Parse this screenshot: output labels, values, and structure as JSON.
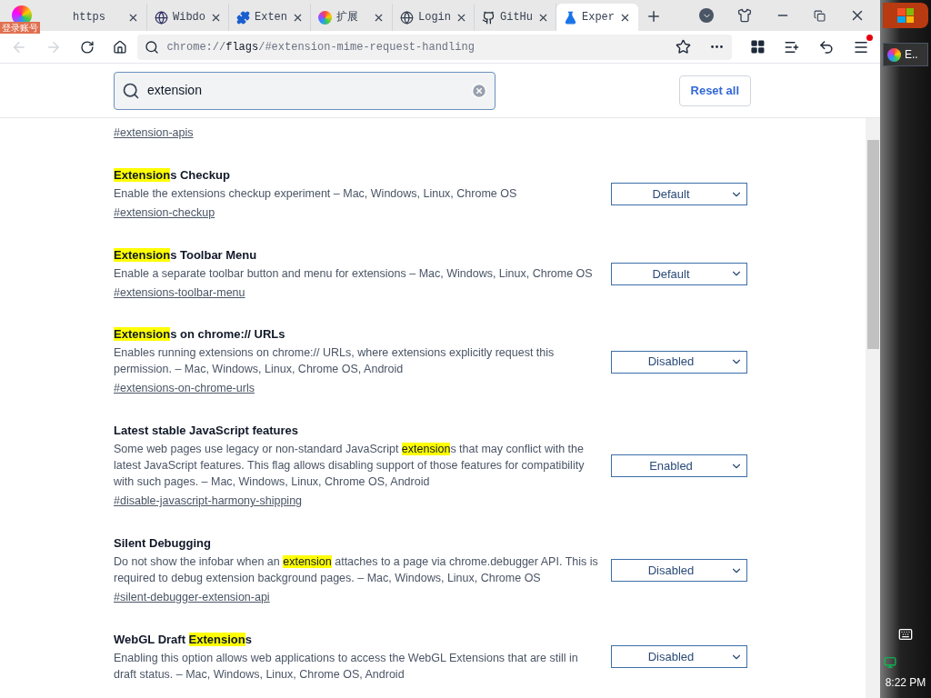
{
  "tabs": [
    {
      "label": "https",
      "kind": "plain",
      "selected": false
    },
    {
      "label": "Wibdo",
      "kind": "globe-dark",
      "selected": false
    },
    {
      "label": "Exten",
      "kind": "puzzle",
      "selected": false
    },
    {
      "label": "扩展",
      "kind": "color-wheel",
      "selected": false
    },
    {
      "label": "Login",
      "kind": "globe",
      "selected": false
    },
    {
      "label": "GitHu",
      "kind": "github",
      "selected": false
    },
    {
      "label": "Exper",
      "kind": "flask",
      "selected": true
    }
  ],
  "account_badge": "登录账号",
  "address": {
    "prefix": "chrome://",
    "host": "flags",
    "path": "/#extension-mime-request-handling"
  },
  "search": {
    "value": "extension"
  },
  "reset_button": "Reset all",
  "flags": [
    {
      "link": "#extension-apis"
    },
    {
      "title": [
        {
          "text": "Extension",
          "highlight": true
        },
        {
          "text": "s Checkup",
          "highlight": false
        }
      ],
      "description": [
        {
          "text": "Enable the extensions checkup experiment – Mac, Windows, Linux, Chrome OS",
          "highlight": false
        }
      ],
      "link": "#extension-checkup",
      "value": "Default"
    },
    {
      "title": [
        {
          "text": "Extension",
          "highlight": true
        },
        {
          "text": "s Toolbar Menu",
          "highlight": false
        }
      ],
      "description": [
        {
          "text": "Enable a separate toolbar button and menu for extensions – Mac, Windows, Linux, Chrome OS",
          "highlight": false
        }
      ],
      "link": "#extensions-toolbar-menu",
      "value": "Default"
    },
    {
      "title": [
        {
          "text": "Extension",
          "highlight": true
        },
        {
          "text": "s on chrome:// URLs",
          "highlight": false
        }
      ],
      "description": [
        {
          "text": "Enables running extensions on chrome:// URLs, where extensions explicitly request this permission. – Mac, Windows, Linux, Chrome OS, Android",
          "highlight": false
        }
      ],
      "link": "#extensions-on-chrome-urls",
      "value": "Disabled"
    },
    {
      "title": [
        {
          "text": "Latest stable JavaScript features",
          "highlight": false
        }
      ],
      "description": [
        {
          "text": "Some web pages use legacy or non-standard JavaScript ",
          "highlight": false
        },
        {
          "text": "extension",
          "highlight": true
        },
        {
          "text": "s that may conflict with the latest JavaScript features. This flag allows disabling support of those features for compatibility with such pages. – Mac, Windows, Linux, Chrome OS, Android",
          "highlight": false
        }
      ],
      "link": "#disable-javascript-harmony-shipping",
      "value": "Enabled"
    },
    {
      "title": [
        {
          "text": "Silent Debugging",
          "highlight": false
        }
      ],
      "description": [
        {
          "text": "Do not show the infobar when an ",
          "highlight": false
        },
        {
          "text": "extension",
          "highlight": true
        },
        {
          "text": " attaches to a page via chrome.debugger API. This is required to debug extension background pages. – Mac, Windows, Linux, Chrome OS",
          "highlight": false
        }
      ],
      "link": "#silent-debugger-extension-api",
      "value": "Disabled"
    },
    {
      "title": [
        {
          "text": "WebGL Draft ",
          "highlight": false
        },
        {
          "text": "Extension",
          "highlight": true
        },
        {
          "text": "s",
          "highlight": false
        }
      ],
      "description": [
        {
          "text": "Enabling this option allows web applications to access the WebGL Extensions that are still in draft status. – Mac, Windows, Linux, Chrome OS, Android",
          "highlight": false
        }
      ],
      "value": "Disabled"
    }
  ],
  "taskbar": {
    "task": "E..",
    "clock": "8:22 PM"
  }
}
